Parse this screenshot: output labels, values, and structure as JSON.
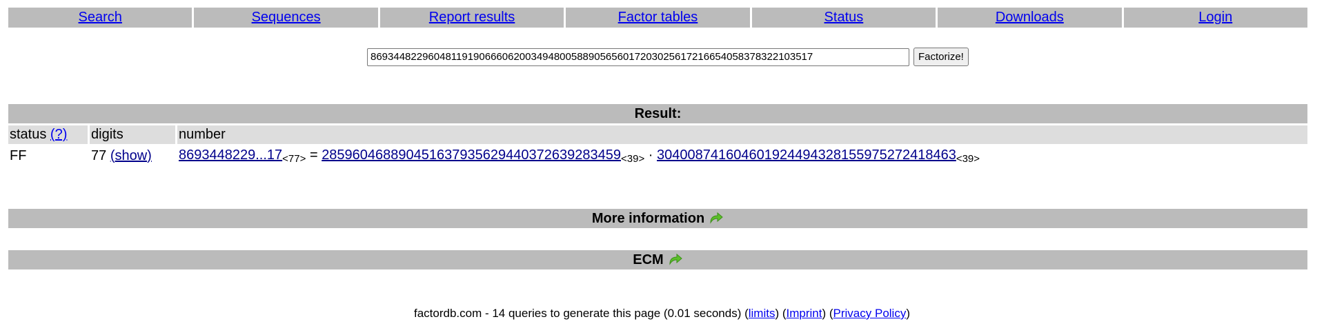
{
  "nav": {
    "items": [
      "Search",
      "Sequences",
      "Report results",
      "Factor tables",
      "Status",
      "Downloads",
      "Login"
    ]
  },
  "search": {
    "value": "86934482296048119190666062003494800588905656017203025617216654058378322103517",
    "button_label": "Factorize!"
  },
  "result": {
    "title": "Result:",
    "columns": {
      "status": "status",
      "status_help": "(?)",
      "digits": "digits",
      "number": "number"
    },
    "row": {
      "status": "FF",
      "digits": "77",
      "show": "(show)",
      "number_short": "8693448229...17",
      "number_len": "<77>",
      "equals": "=",
      "factor1": "285960468890451637935629440372639283459",
      "factor1_len": "<39>",
      "dot": "·",
      "factor2": "304008741604601924494328155975272418463",
      "factor2_len": "<39>"
    }
  },
  "sections": {
    "more_info": "More information",
    "ecm": "ECM"
  },
  "footer": {
    "prefix": "factordb.com - 14 queries to generate this page (0.01 seconds) (",
    "limits": "limits",
    "sep1": ") (",
    "imprint": "Imprint",
    "sep2": ") (",
    "privacy": "Privacy Policy",
    "suffix": ")"
  },
  "colors": {
    "bar": "#bbbbbb",
    "subheader": "#dddddd",
    "link": "#0000ee",
    "arrow": "#4caf2f"
  }
}
